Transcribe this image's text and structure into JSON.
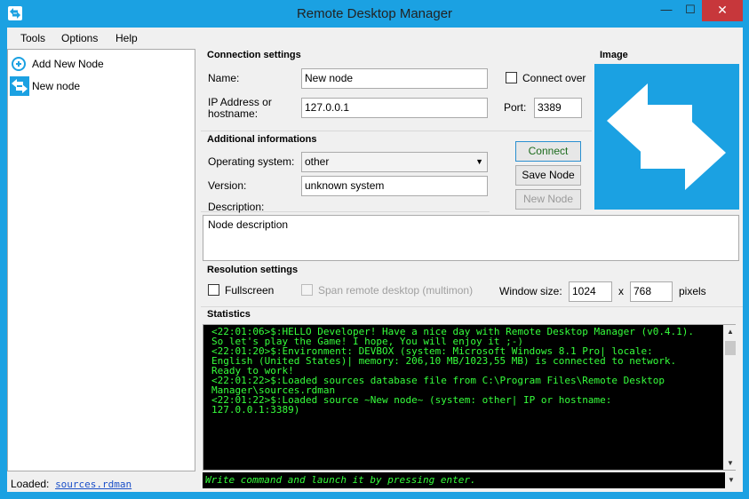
{
  "window": {
    "title": "Remote Desktop Manager",
    "minimize": "—",
    "maximize": "☐",
    "close": "✕"
  },
  "menu": [
    "Tools",
    "Options",
    "Help"
  ],
  "tree": {
    "items": [
      "Add New Node",
      "New node"
    ]
  },
  "status": {
    "label": "Loaded:",
    "file": "sources.rdman"
  },
  "connection": {
    "title": "Connection settings",
    "name_label": "Name:",
    "name_value": "New node",
    "connect_over_label": "Connect over",
    "ip_label_line1": "IP Address or",
    "ip_label_line2": "hostname:",
    "ip_value": "127.0.0.1",
    "port_label": "Port:",
    "port_value": "3389"
  },
  "image": {
    "title": "Image"
  },
  "additional": {
    "title": "Additional informations",
    "os_label": "Operating system:",
    "os_value": "other",
    "version_label": "Version:",
    "version_value": "unknown system",
    "description_label": "Description:",
    "description_value": "Node description"
  },
  "buttons": {
    "connect": "Connect",
    "save": "Save Node",
    "new": "New Node"
  },
  "resolution": {
    "title": "Resolution settings",
    "fullscreen_label": "Fullscreen",
    "span_label": "Span remote desktop (multimon)",
    "window_size_label": "Window size:",
    "width": "1024",
    "x_label": "x",
    "height": "768",
    "pixels_label": "pixels"
  },
  "statistics": {
    "title": "Statistics",
    "log": [
      "<22:01:06>$:HELLO Developer! Have a nice day with Remote Desktop Manager (v0.4.1).",
      "So let's play the Game! I hope, You will enjoy it ;-)",
      "<22:01:20>$:Environment: DEVBOX (system: Microsoft Windows 8.1 Pro| locale:",
      "English (United States)| memory: 206,10 MB/1023,55 MB) is connected to network.",
      "Ready to work!",
      "<22:01:22>$:Loaded sources database file from C:\\Program Files\\Remote Desktop",
      "Manager\\sources.rdman",
      "<22:01:22>$:Loaded source ~New node~ (system: other| IP or hostname:",
      "127.0.0.1:3389)"
    ],
    "command_placeholder": "Write command and launch it by pressing enter."
  },
  "colors": {
    "accent": "#1ba1e2",
    "console_text": "#36ff3c",
    "close": "#c7373b"
  }
}
